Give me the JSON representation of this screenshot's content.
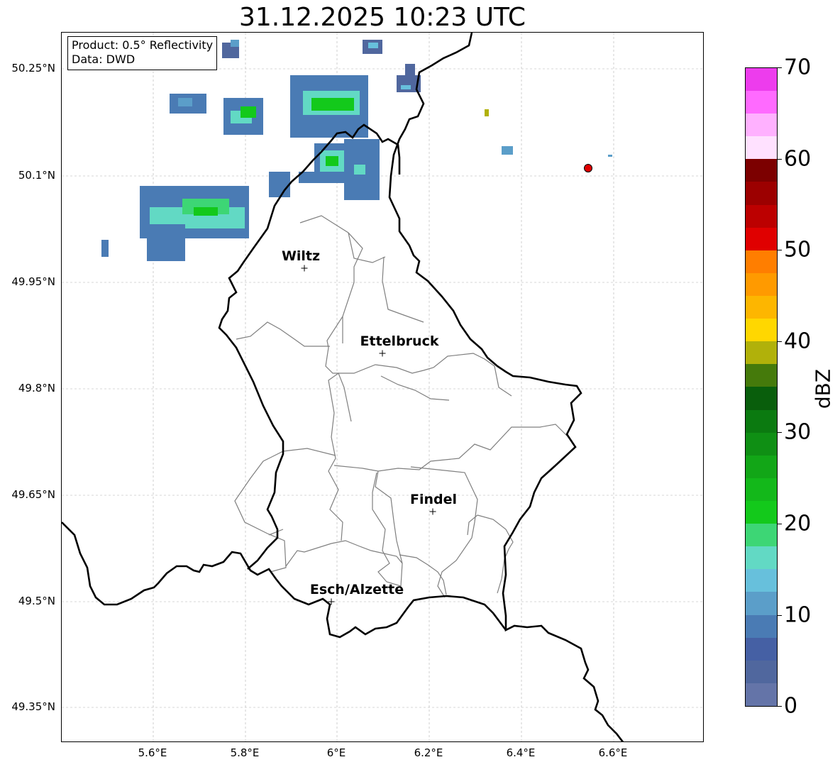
{
  "title": "31.12.2025 10:23 UTC",
  "info_box": {
    "product": "Product: 0.5° Reflectivity",
    "data": "Data: DWD"
  },
  "axes": {
    "lat_labels": [
      "50.25°N",
      "50.1°N",
      "49.95°N",
      "49.8°N",
      "49.65°N",
      "49.5°N",
      "49.35°N"
    ],
    "lon_labels": [
      "5.6°E",
      "5.8°E",
      "6°E",
      "6.2°E",
      "6.4°E",
      "6.6°E"
    ],
    "grid": true
  },
  "cities": [
    {
      "name": "Wiltz"
    },
    {
      "name": "Ettelbruck"
    },
    {
      "name": "Findel"
    },
    {
      "name": "Esch/Alzette"
    }
  ],
  "colorbar": {
    "label": "dBZ",
    "ticks": [
      "0",
      "10",
      "20",
      "30",
      "40",
      "50",
      "60",
      "70"
    ],
    "colors": [
      "#6474a8",
      "#50679e",
      "#4560a4",
      "#4a7bb4",
      "#5b9ec9",
      "#67c0dc",
      "#62d9c4",
      "#3dd675",
      "#13c91b",
      "#13b81a",
      "#12a617",
      "#0f8f14",
      "#0b7a10",
      "#095e0c",
      "#457a0b",
      "#b1b10a",
      "#ffd700",
      "#fdb600",
      "#ff9a00",
      "#ff7e00",
      "#e00000",
      "#bc0000",
      "#9c0000",
      "#7c0000",
      "#ffe1ff",
      "#ffb1ff",
      "#ff6aff",
      "#ed3ced"
    ]
  },
  "colors": {
    "border": "#000000",
    "districts": "#7f7f7f",
    "grid": "#b0b0b0",
    "radar_site": "#e00000"
  }
}
